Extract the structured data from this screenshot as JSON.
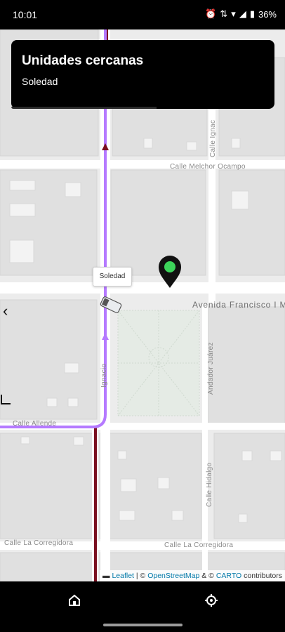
{
  "status": {
    "time": "10:01",
    "battery": "36%"
  },
  "panel": {
    "title": "Unidades cercanas",
    "subtitle": "Soledad"
  },
  "map": {
    "tooltip": "Soledad",
    "streets": {
      "s1": "Calle Melchor Ocampo",
      "s2": "Avenida Francisco I M",
      "s3": "Calle La Corregidora",
      "s4": "Calle La Corregidora",
      "s5": "Calle Allende",
      "s6": "Calle Hidalgo",
      "s7": "Andador Juárez",
      "s8": "Calle Ignac",
      "s9": "Ignacio"
    },
    "route_color": "#b57aff",
    "rail_color": "#7a1020",
    "marker_color": "#3cd35a"
  },
  "attribution": {
    "leaflet": "Leaflet",
    "sep1": " | © ",
    "osm": "OpenStreetMap",
    "sep2": " & © ",
    "carto": "CARTO",
    "tail": " contributors"
  },
  "nav": {
    "home_icon": "home-icon",
    "settings_icon": "gear-icon"
  }
}
